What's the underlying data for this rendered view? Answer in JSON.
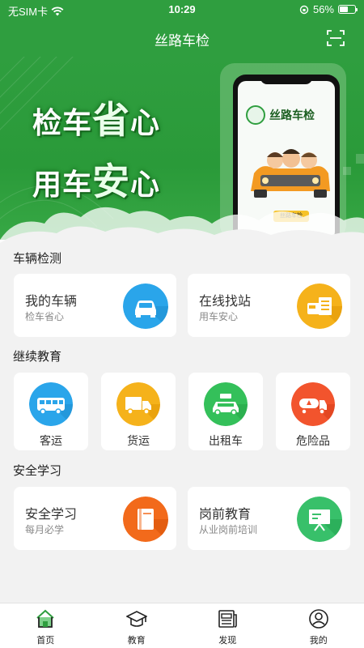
{
  "status": {
    "carrier": "无SIM卡",
    "time": "10:29",
    "battery": "56%",
    "battery_fraction": 0.56
  },
  "header": {
    "title": "丝路车检",
    "scan_icon": "scan-icon"
  },
  "banner": {
    "line1_a": "检车",
    "line1_b": "省",
    "line1_c": "心",
    "line2_a": "用车",
    "line2_b": "安",
    "line2_c": "心",
    "phone_brand": "丝路车检",
    "phone_plate": "丝路车检"
  },
  "vehicle_section": {
    "title": "车辆检测",
    "cards": [
      {
        "title": "我的车辆",
        "subtitle": "检车省心",
        "icon": "car-icon",
        "color": "#2aa5ea"
      },
      {
        "title": "在线找站",
        "subtitle": "用车安心",
        "icon": "station-icon",
        "color": "#f5b21b"
      }
    ]
  },
  "education_section": {
    "title": "继续教育",
    "items": [
      {
        "label": "客运",
        "icon": "bus-icon",
        "color": "#2aa5ea"
      },
      {
        "label": "货运",
        "icon": "truck-icon",
        "color": "#f5b21b"
      },
      {
        "label": "出租车",
        "icon": "taxi-icon",
        "color": "#34c05a"
      },
      {
        "label": "危险品",
        "icon": "tanker-icon",
        "color": "#f2542d"
      }
    ]
  },
  "safety_section": {
    "title": "安全学习",
    "cards": [
      {
        "title": "安全学习",
        "subtitle": "每月必学",
        "icon": "book-icon",
        "color": "#f26a1b"
      },
      {
        "title": "岗前教育",
        "subtitle": "从业岗前培训",
        "icon": "presentation-icon",
        "color": "#38c06a"
      }
    ]
  },
  "tabbar": {
    "active_color": "#2f9e3f",
    "items": [
      {
        "label": "首页",
        "icon": "home-icon"
      },
      {
        "label": "教育",
        "icon": "graduation-cap-icon"
      },
      {
        "label": "发现",
        "icon": "newspaper-icon"
      },
      {
        "label": "我的",
        "icon": "profile-icon"
      }
    ]
  }
}
